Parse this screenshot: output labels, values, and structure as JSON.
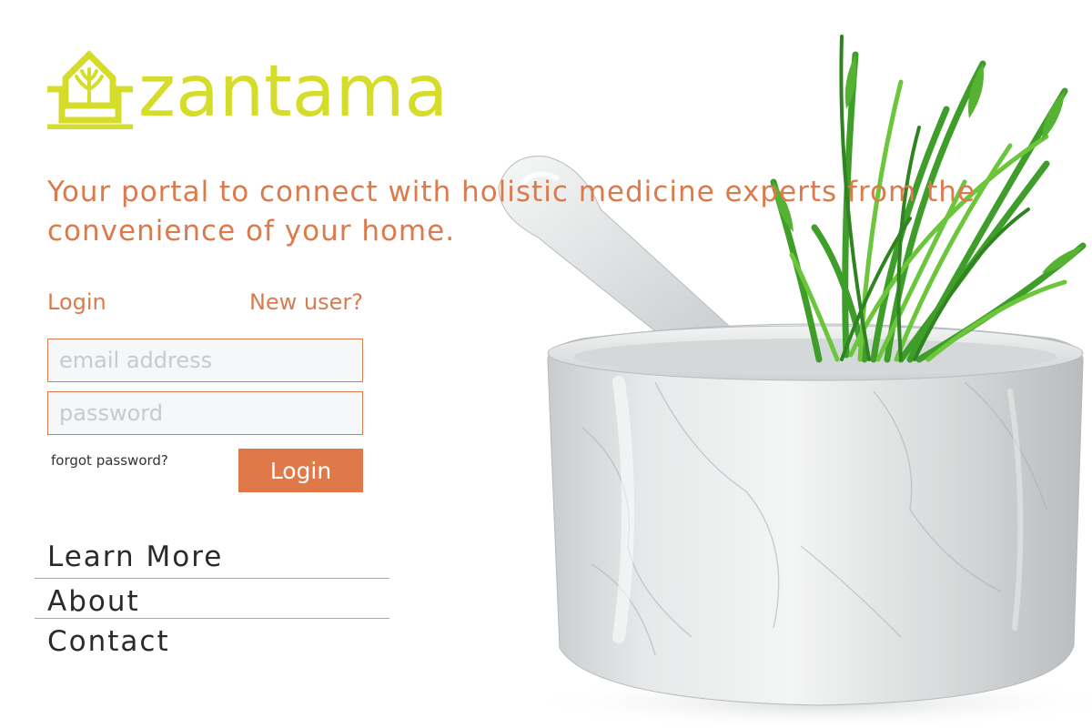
{
  "brand": {
    "name": "zantama",
    "logo_icon": "leaf-tree-icon",
    "logo_color": "#d6dc2a"
  },
  "tagline": "Your portal to connect with holistic medicine experts from the convenience of your home.",
  "auth": {
    "login_tab": "Login",
    "new_user_tab": "New user?",
    "email_placeholder": "email address",
    "password_placeholder": "password",
    "forgot_password": "forgot password?",
    "login_button": "Login"
  },
  "nav": {
    "items": [
      "Learn More",
      "About",
      "Contact"
    ]
  },
  "colors": {
    "accent": "#dc7a4c",
    "brand": "#d6dc2a",
    "nav_text": "#2a2a2a"
  },
  "hero": {
    "image": "marble-mortar-pestle-with-herbs"
  }
}
